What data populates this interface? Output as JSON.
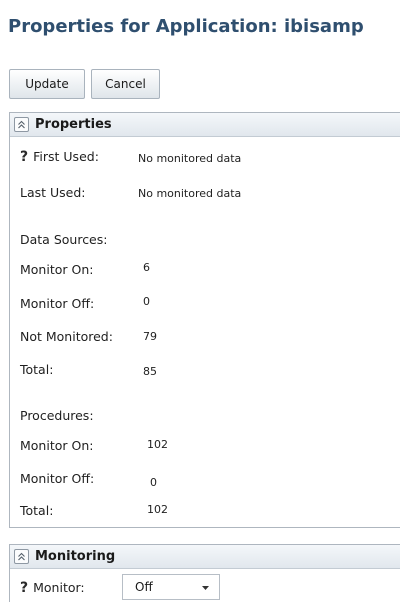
{
  "page": {
    "title": "Properties for Application: ibisamp"
  },
  "toolbar": {
    "update_label": "Update",
    "cancel_label": "Cancel"
  },
  "properties_panel": {
    "title": "Properties",
    "help_icon": "question-mark-icon",
    "first_used": {
      "label": "First Used:",
      "value": "No monitored data"
    },
    "last_used": {
      "label": "Last Used:",
      "value": "No monitored data"
    },
    "data_sources": {
      "heading": "Data Sources:",
      "monitor_on": {
        "label": "Monitor On:",
        "value": "6"
      },
      "monitor_off": {
        "label": "Monitor Off:",
        "value": "0"
      },
      "not_monitored": {
        "label": "Not Monitored:",
        "value": "79"
      },
      "total": {
        "label": "Total:",
        "value": "85"
      }
    },
    "procedures": {
      "heading": "Procedures:",
      "monitor_on": {
        "label": "Monitor On:",
        "value": "102"
      },
      "monitor_off": {
        "label": "Monitor Off:",
        "value": "0"
      },
      "total": {
        "label": "Total:",
        "value": "102"
      }
    }
  },
  "monitoring_panel": {
    "title": "Monitoring",
    "help_icon": "question-mark-icon",
    "monitor": {
      "label": "Monitor:",
      "selected": "Off"
    }
  },
  "colors": {
    "title_text": "#2f4f6f",
    "panel_border": "#aeb6bf",
    "header_bg": "#e1e7ed"
  }
}
